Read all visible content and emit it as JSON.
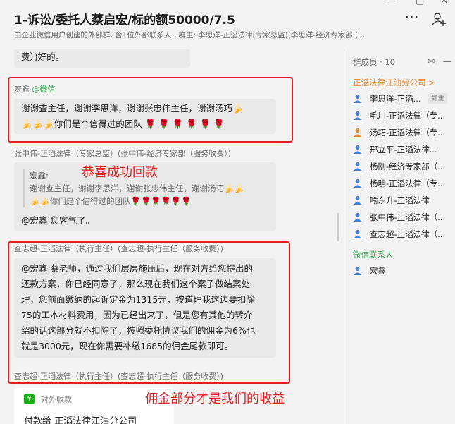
{
  "header": {
    "title": "1-诉讼/委托人蔡启宏/标的额50000/7.5",
    "subtitle": "由企业微信用户创建的外部群, 含1位外部联系人 · 群主: 李思洋-正滔法律(专家总监)(李思洋-经济专家部 (..."
  },
  "chat": {
    "top_fragment": "费）)好的。",
    "msg1": {
      "sender": "宏鑫",
      "sender_tag": "@微信",
      "line1": "谢谢查主任，谢谢李思洋，谢谢张忠伟主任，谢谢汤巧",
      "line2_text": "你们是个信得过的团队"
    },
    "msg2": {
      "sender": "张中伟-正滔法律（专家总监）(张中伟-经济专家部（服务收费）)",
      "quote_name": "宏鑫:",
      "quote_line1": "谢谢查主任，谢谢李思洋，谢谢张忠伟主任，谢谢汤巧",
      "quote_line2": "你们是个信得过的团队",
      "reply": "@宏鑫 您客气了。"
    },
    "msg3": {
      "sender": "查志超-正滔法律（执行主任）(查志超-执行主任（服务收费）)",
      "lines": [
        "@宏鑫 蔡老师，通过我们层层施压后，现在对方给您提出的",
        "还款方案，你已经同意了，那么现在我们这个案子做结案处",
        "理，您前面缴纳的起诉定金为1315元，按道理我这边要扣除",
        "75的工本材料费用，因为已经出来了，但是您有其他的转介",
        "绍的话这部分就不扣除了，按照委托协议我们的佣金为6%也",
        "就是3000元，现在你需要补缴1685的佣金尾款即可。"
      ]
    },
    "msg4": {
      "sender": "查志超-正滔法律（执行主任）(查志超-执行主任（服务收费）)"
    },
    "payment": {
      "type": "对外收款",
      "desc": "付款给 正滔法律江油分公司"
    },
    "annotations": {
      "a1": "恭喜成功回款",
      "a2": "佣金部分才是我们的收益"
    }
  },
  "sidebar": {
    "members_label": "群成员 · 10",
    "group1": "正滔法律江油分公司 >",
    "members": [
      {
        "name": "李思洋-正滔...",
        "tag": "群主"
      },
      {
        "name": "毛川-正滔法律（专..."
      },
      {
        "name": "汤巧-正滔法律（专..."
      },
      {
        "name": "邢立平-正滔法律..."
      },
      {
        "name": "杨刚-经济专家部（..."
      },
      {
        "name": "杨明-正滔法律（专..."
      },
      {
        "name": "喻东升-正滔法律"
      },
      {
        "name": "张中伟-正滔法律（..."
      },
      {
        "name": "查志超-正滔法律（..."
      }
    ],
    "group2": "微信联系人",
    "wechat_members": [
      {
        "name": "宏鑫"
      }
    ]
  },
  "colors": {
    "accent_red": "#e02020",
    "orange_group": "#e8892f",
    "wechat_green": "#2ea44f",
    "bubble": "#e9e9e9"
  }
}
